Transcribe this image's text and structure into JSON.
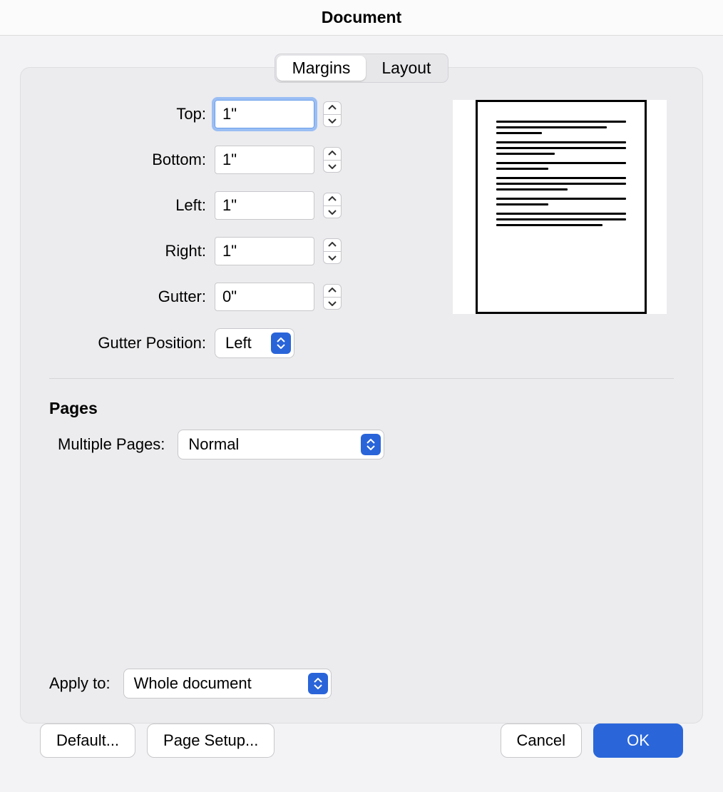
{
  "title": "Document",
  "tabs": {
    "margins": "Margins",
    "layout": "Layout",
    "active": "margins"
  },
  "margins": {
    "top": {
      "label": "Top:",
      "value": "1\""
    },
    "bottom": {
      "label": "Bottom:",
      "value": "1\""
    },
    "left": {
      "label": "Left:",
      "value": "1\""
    },
    "right": {
      "label": "Right:",
      "value": "1\""
    },
    "gutter": {
      "label": "Gutter:",
      "value": "0\""
    },
    "gutter_position": {
      "label": "Gutter Position:",
      "value": "Left"
    }
  },
  "pages": {
    "heading": "Pages",
    "multiple": {
      "label": "Multiple Pages:",
      "value": "Normal"
    }
  },
  "apply_to": {
    "label": "Apply to:",
    "value": "Whole document"
  },
  "buttons": {
    "default": "Default...",
    "page_setup": "Page Setup...",
    "cancel": "Cancel",
    "ok": "OK"
  }
}
